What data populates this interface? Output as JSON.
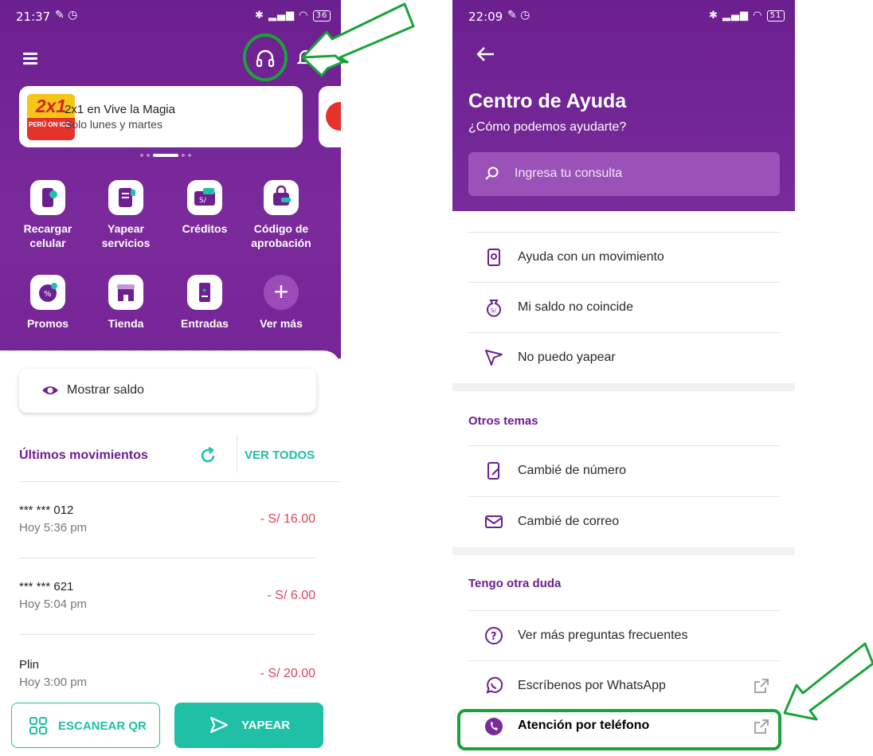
{
  "left": {
    "status": {
      "time": "21:37",
      "battery": "36"
    },
    "promo": {
      "logo_text": "2x1",
      "logo_brand": "PERÚ ON ICE",
      "title": "2x1 en Vive la Magia",
      "subtitle": "Solo lunes y martes"
    },
    "services": [
      {
        "label": "Recargar\ncelular",
        "icon": "phone-recharge-icon"
      },
      {
        "label": "Yapear\nservicios",
        "icon": "bill-icon"
      },
      {
        "label": "Créditos",
        "icon": "credit-icon"
      },
      {
        "label": "Código de\naprobación",
        "icon": "approval-code-icon"
      },
      {
        "label": "Promos",
        "icon": "promo-icon"
      },
      {
        "label": "Tienda",
        "icon": "store-icon"
      },
      {
        "label": "Entradas",
        "icon": "ticket-icon"
      },
      {
        "label": "Ver más",
        "icon": "plus-icon"
      }
    ],
    "balance_button": "Mostrar saldo",
    "movements_title": "Últimos movimientos",
    "see_all": "VER TODOS",
    "movements": [
      {
        "name": "*** *** 012",
        "time": "Hoy 5:36 pm",
        "amount": "- S/ 16.00"
      },
      {
        "name": "*** *** 621",
        "time": "Hoy 5:04 pm",
        "amount": "- S/ 6.00"
      },
      {
        "name": "Plin",
        "time": "Hoy 3:00 pm",
        "amount": "- S/ 20.00"
      }
    ],
    "scan_button": "ESCANEAR QR",
    "yapear_button": "YAPEAR"
  },
  "right": {
    "status": {
      "time": "22:09",
      "battery": "51"
    },
    "title": "Centro de Ayuda",
    "subtitle": "¿Cómo podemos ayudarte?",
    "search_placeholder": "Ingresa tu consulta",
    "items_main": [
      {
        "label": "Ayuda con un movimiento",
        "icon": "movement-help-icon"
      },
      {
        "label": "Mi saldo no coincide",
        "icon": "money-bag-icon"
      },
      {
        "label": "No puedo yapear",
        "icon": "send-icon"
      }
    ],
    "section_other": "Otros temas",
    "items_other": [
      {
        "label": "Cambié de número",
        "icon": "phone-edit-icon"
      },
      {
        "label": "Cambié de correo",
        "icon": "mail-icon"
      }
    ],
    "section_doubt": "Tengo otra duda",
    "items_doubt": [
      {
        "label": "Ver más preguntas frecuentes",
        "icon": "question-icon"
      },
      {
        "label": "Escríbenos por WhatsApp",
        "icon": "whatsapp-icon"
      },
      {
        "label": "Atención por teléfono",
        "icon": "phone-call-icon"
      }
    ]
  },
  "colors": {
    "purple": "#6c1f8f",
    "teal": "#1fbfa8",
    "red": "#e04455",
    "annotation_green": "#1aa33a"
  }
}
